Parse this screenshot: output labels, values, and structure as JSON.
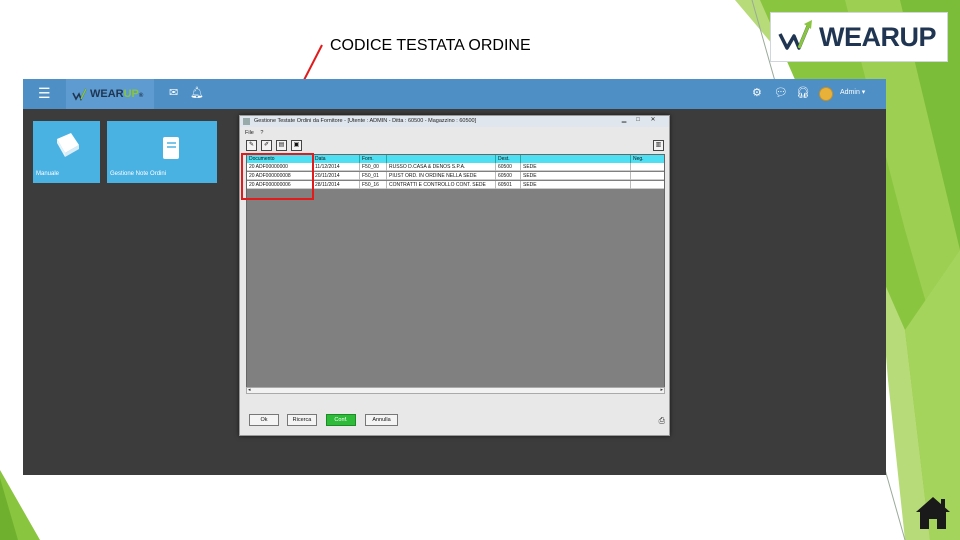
{
  "caption": "CODICE TESTATA ORDINE",
  "logo": {
    "text": "WEARUP"
  },
  "app": {
    "topbar": {
      "brand_text_a": "WEAR",
      "brand_text_b": "UP",
      "brand_text_c": "®",
      "user_label": "Admin ▾"
    },
    "tiles": [
      {
        "label": "Manuale"
      },
      {
        "label": "Gestione Note Ordini"
      }
    ],
    "window": {
      "title": "Gestione Testate Ordini da Fornitore - [Utente : ADMIN - Ditta : 60500 - Magazzino : 60500]",
      "menu": [
        "File",
        "?"
      ],
      "columns": [
        "Documento",
        "Data",
        "Forn.",
        "",
        "Dest.",
        "",
        "Neg."
      ],
      "rows": [
        {
          "doc": "20 ADF00000000",
          "data": "11/12/2014",
          "forn": "F50_00",
          "desc": "RUSSO D.CASA & DENOS S.P.A.",
          "dest": "60500",
          "dest2": "SEDE",
          "neg": ""
        },
        {
          "doc": "20 ADF000000008",
          "data": "20/11/2014",
          "forn": "F50_01",
          "desc": "PIUST ORD. IN ORDINE NELLA SEDE",
          "dest": "60500",
          "dest2": "SEDE",
          "neg": ""
        },
        {
          "doc": "20 ADF000000006",
          "data": "28/11/2014",
          "forn": "F50_16",
          "desc": "CONTRATTI E CONTROLLO CONT. SEDE",
          "dest": "60501",
          "dest2": "SEDE",
          "neg": ""
        }
      ],
      "buttons": {
        "ok": "Ok",
        "ricerca": "Ricerca",
        "conferma": "Conf.",
        "annulla": "Annulla"
      }
    }
  },
  "colors": {
    "topbar": "#4e8fc5",
    "tile": "#4ab2e3",
    "grid_header": "#4ee0f2",
    "highlight": "#e11b1b",
    "accent_green": "#8ac53f"
  }
}
